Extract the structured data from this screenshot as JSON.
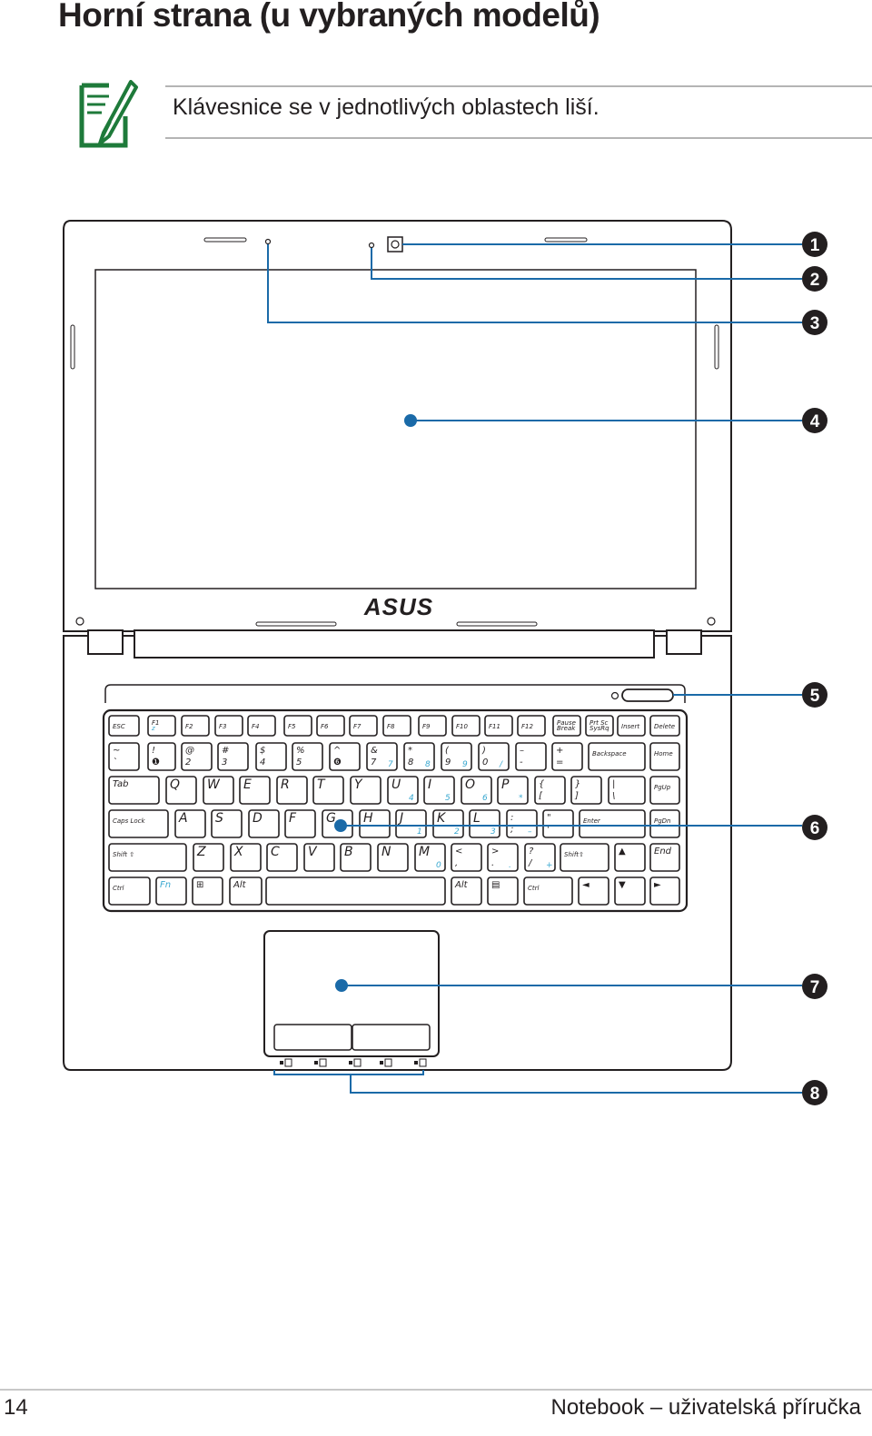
{
  "page": {
    "title": "Horní strana (u vybraných modelů)",
    "note": "Klávesnice se v jednotlivých oblastech liší.",
    "note_icon": "note-pen-icon",
    "page_number": "14",
    "footer": "Notebook – uživatelská příručka"
  },
  "colors": {
    "accent": "#1a6aa8",
    "note_icon": "#1e7a3a",
    "text": "#231f20",
    "key_blue": "#3aa8d0"
  },
  "diagram": {
    "logo": "ASUS",
    "callouts": [
      "1",
      "2",
      "3",
      "4",
      "5",
      "6",
      "7",
      "8"
    ],
    "keyboard": {
      "rows": [
        [
          [
            "ESC",
            ""
          ],
          [
            "F1",
            "z"
          ],
          [
            "F2",
            ""
          ],
          [
            "F3",
            ""
          ],
          [
            "F4",
            ""
          ],
          [
            "F5",
            ""
          ],
          [
            "F6",
            ""
          ],
          [
            "F7",
            ""
          ],
          [
            "F8",
            ""
          ],
          [
            "F9",
            ""
          ],
          [
            "F10",
            ""
          ],
          [
            "F11",
            ""
          ],
          [
            "F12",
            ""
          ],
          [
            "Pause",
            "Break"
          ],
          [
            "Prt Sc",
            "SysRq"
          ],
          [
            "Insert",
            ""
          ],
          [
            "Delete",
            ""
          ]
        ],
        [
          [
            "~",
            "`"
          ],
          [
            "!",
            "❶"
          ],
          [
            "@",
            "2"
          ],
          [
            "#",
            "3"
          ],
          [
            "$",
            "4"
          ],
          [
            "%",
            "5"
          ],
          [
            "^",
            "❻"
          ],
          [
            "&",
            "7"
          ],
          [
            "*",
            "8"
          ],
          [
            "(",
            "9"
          ],
          [
            ")",
            "0"
          ],
          [
            "–",
            "-"
          ],
          [
            "+",
            "="
          ],
          [
            "Backspace",
            ""
          ],
          [
            "Home",
            ""
          ]
        ],
        [
          [
            "Tab",
            ""
          ],
          [
            "Q",
            ""
          ],
          [
            "W",
            ""
          ],
          [
            "E",
            ""
          ],
          [
            "R",
            ""
          ],
          [
            "T",
            ""
          ],
          [
            "Y",
            ""
          ],
          [
            "U",
            ""
          ],
          [
            "I",
            ""
          ],
          [
            "O",
            ""
          ],
          [
            "P",
            ""
          ],
          [
            "{",
            "["
          ],
          [
            "}",
            "]"
          ],
          [
            "|",
            "\\"
          ],
          [
            "PgUp",
            ""
          ]
        ],
        [
          [
            "Caps Lock",
            ""
          ],
          [
            "A",
            ""
          ],
          [
            "S",
            ""
          ],
          [
            "D",
            ""
          ],
          [
            "F",
            ""
          ],
          [
            "G",
            ""
          ],
          [
            "H",
            ""
          ],
          [
            "J",
            ""
          ],
          [
            "K",
            ""
          ],
          [
            "L",
            ""
          ],
          [
            ":",
            ";"
          ],
          [
            "\"",
            "'"
          ],
          [
            "Enter",
            ""
          ],
          [
            "PgDn",
            ""
          ]
        ],
        [
          [
            "Shift ⇧",
            ""
          ],
          [
            "Z",
            ""
          ],
          [
            "X",
            ""
          ],
          [
            "C",
            ""
          ],
          [
            "V",
            ""
          ],
          [
            "B",
            ""
          ],
          [
            "N",
            ""
          ],
          [
            "M",
            ""
          ],
          [
            "<",
            ","
          ],
          [
            ">",
            "."
          ],
          [
            "?",
            "/"
          ],
          [
            "Shift⇧",
            ""
          ],
          [
            "▲",
            ""
          ],
          [
            "End",
            ""
          ]
        ],
        [
          [
            "Ctrl",
            ""
          ],
          [
            "Fn",
            ""
          ],
          [
            "⊞",
            ""
          ],
          [
            "Alt",
            ""
          ],
          [
            "",
            ""
          ],
          [
            "Alt",
            ""
          ],
          [
            "▤",
            ""
          ],
          [
            "Ctrl",
            ""
          ],
          [
            "◄",
            ""
          ],
          [
            "▼",
            ""
          ],
          [
            "►",
            ""
          ]
        ]
      ],
      "numpad_blue": {
        "7": "7",
        "8": "8",
        "9": "9",
        "0": "/",
        "U": "4",
        "I": "5",
        "O": "6",
        "P": "*",
        "J": "1",
        "K": "2",
        "L": "3",
        ":": "–",
        "M": "0",
        ">": ".",
        "?": "+"
      }
    }
  }
}
